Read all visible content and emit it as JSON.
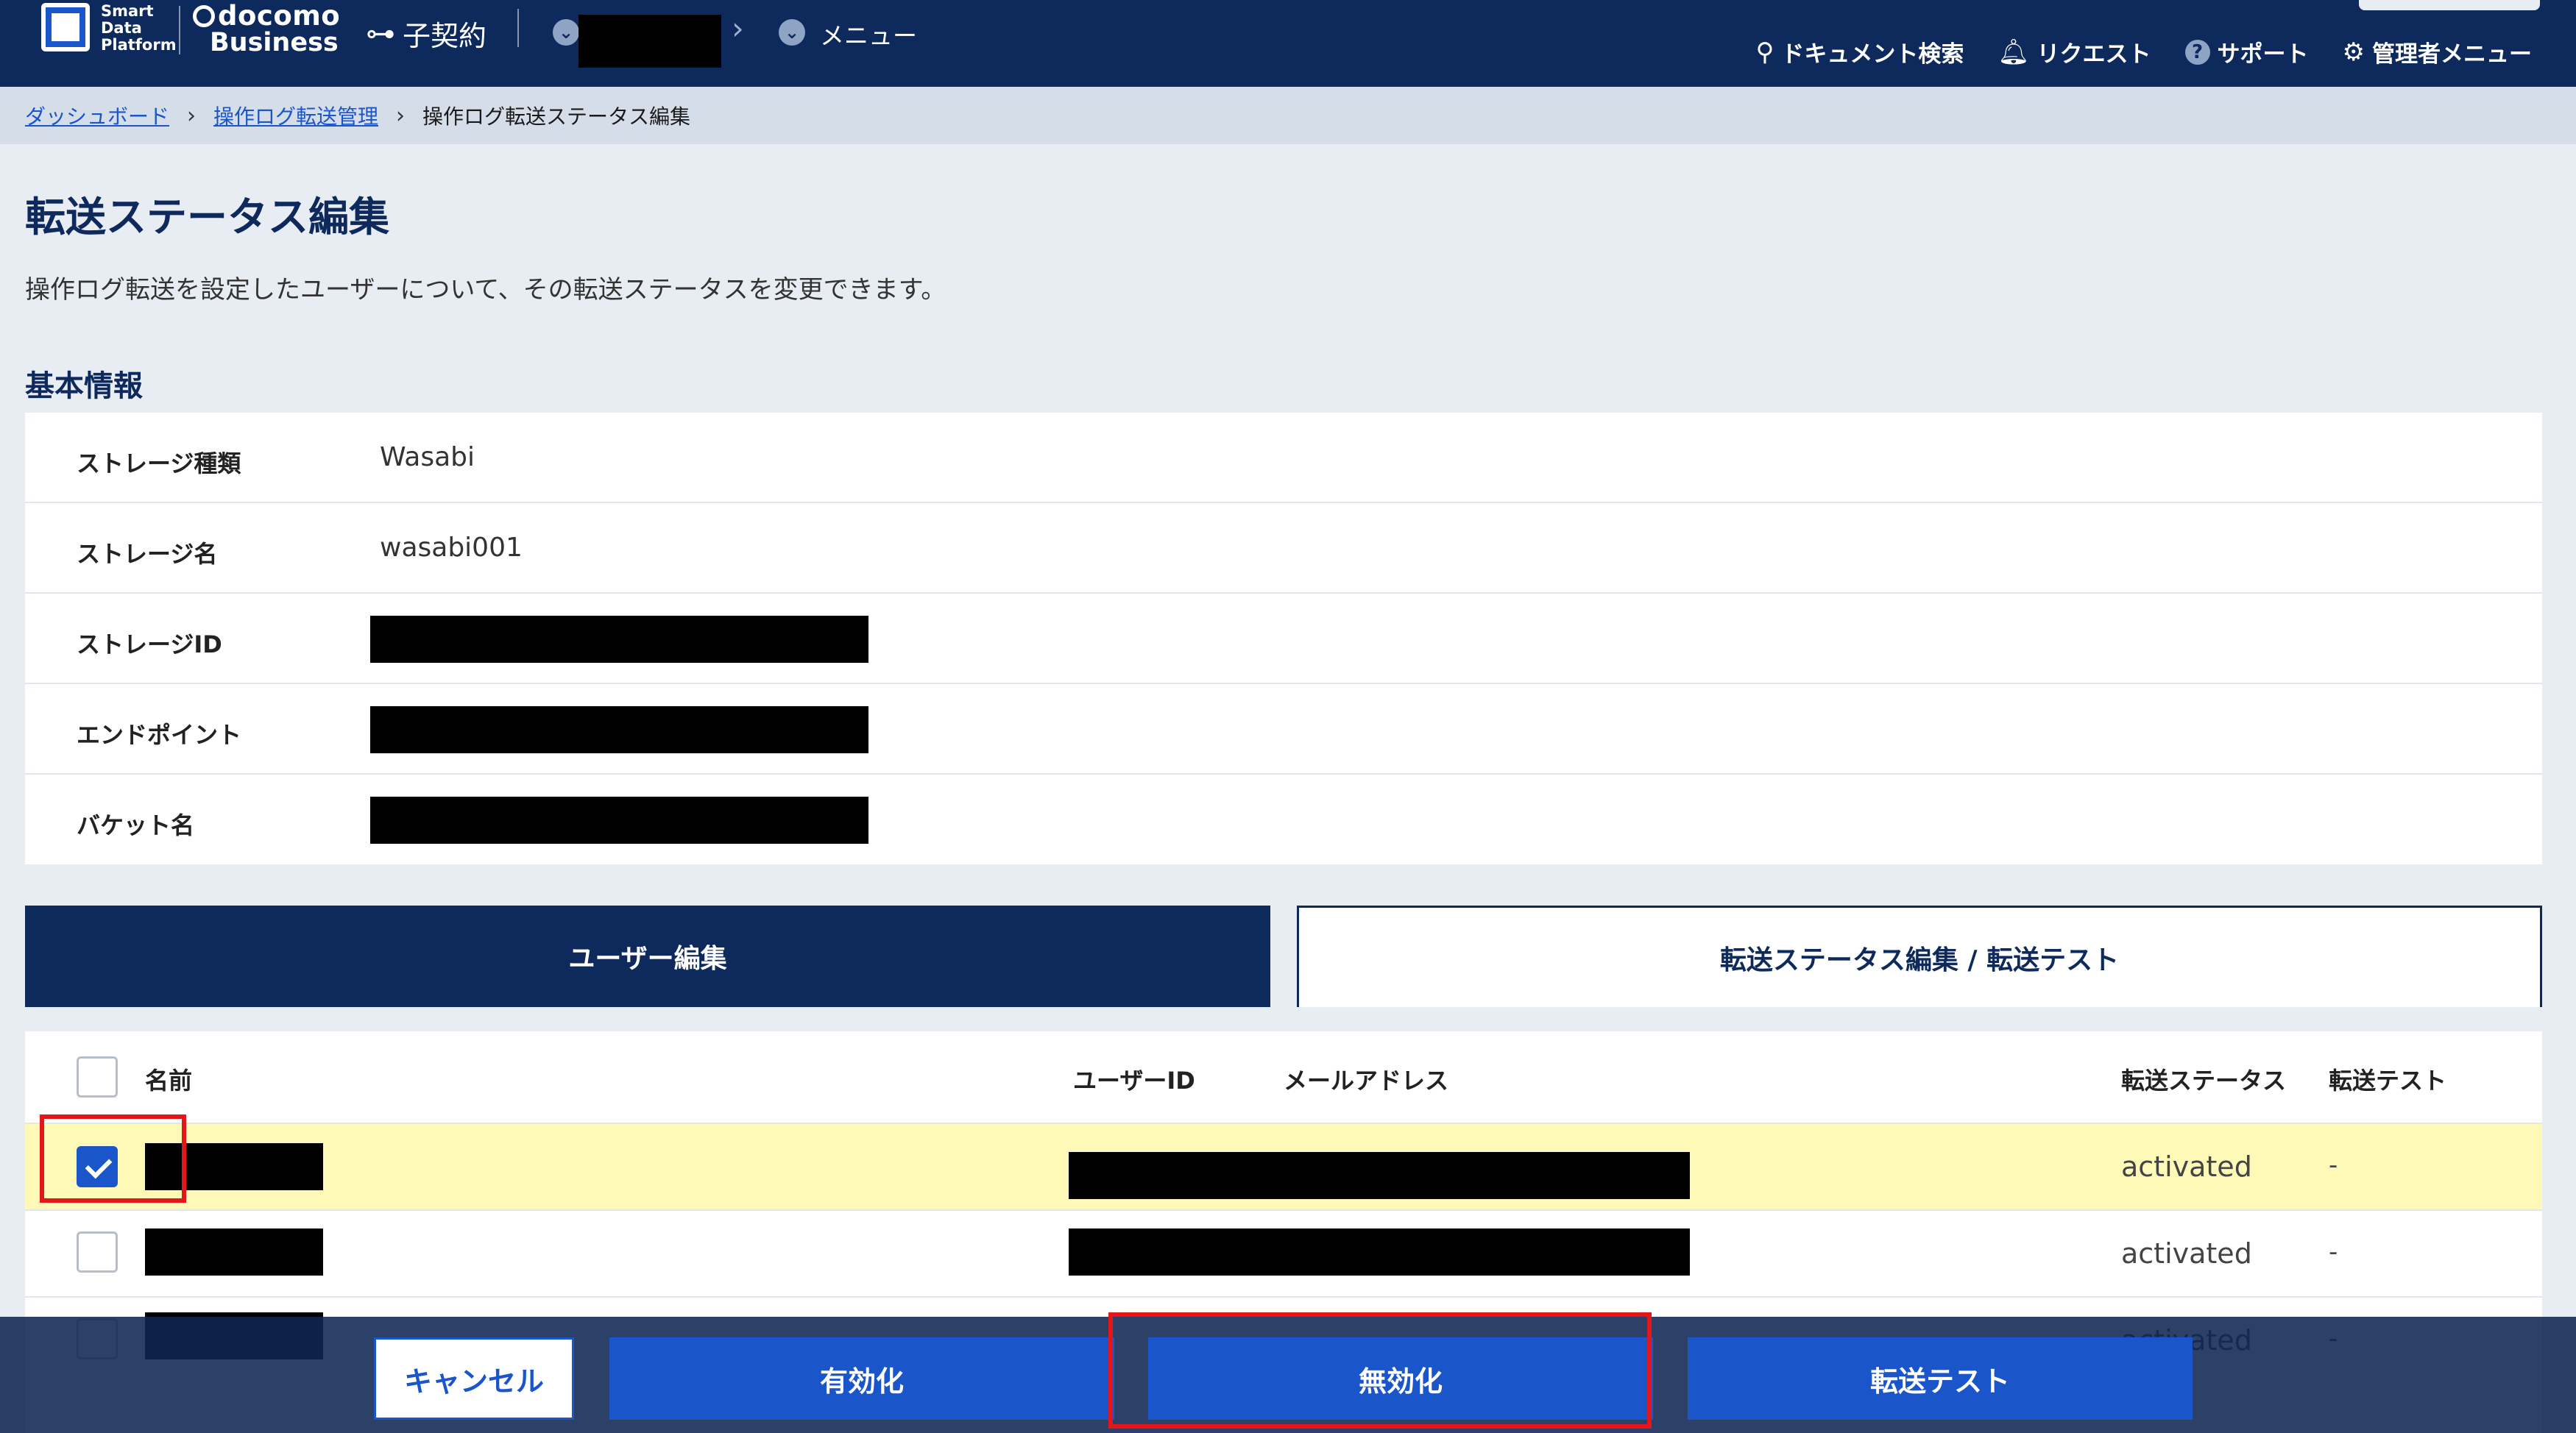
{
  "header": {
    "logo_text": [
      "Smart",
      "Data",
      "Platform"
    ],
    "docomo": "docomo",
    "business": "Business",
    "contract_label": "子契約",
    "menu_label": "メニュー",
    "links": [
      {
        "name": "document-search",
        "icon": "search-icon",
        "glyph": "⚲",
        "label": "ドキュメント検索"
      },
      {
        "name": "request",
        "icon": "bell-icon",
        "glyph": "🔔",
        "label": "リクエスト"
      },
      {
        "name": "support",
        "icon": "help-icon",
        "glyph": "?",
        "label": "サポート"
      },
      {
        "name": "admin-menu",
        "icon": "gear-icon",
        "glyph": "⚙",
        "label": "管理者メニュー"
      }
    ]
  },
  "breadcrumb": {
    "items": [
      "ダッシュボード",
      "操作ログ転送管理",
      "操作ログ転送ステータス編集"
    ]
  },
  "page": {
    "title": "転送ステータス編集",
    "description": "操作ログ転送を設定したユーザーについて、その転送ステータスを変更できます。",
    "section_title": "基本情報"
  },
  "info": {
    "rows": [
      {
        "label": "ストレージ種類",
        "value": "Wasabi",
        "redacted": false
      },
      {
        "label": "ストレージ名",
        "value": "wasabi001",
        "redacted": false
      },
      {
        "label": "ストレージID",
        "value": "",
        "redacted": true
      },
      {
        "label": "エンドポイント",
        "value": "",
        "redacted": true
      },
      {
        "label": "バケット名",
        "value": "",
        "redacted": true
      }
    ]
  },
  "tabs": {
    "user_edit": "ユーザー編集",
    "status_edit": "転送ステータス編集 / 転送テスト"
  },
  "table": {
    "columns": {
      "name": "名前",
      "user_id": "ユーザーID",
      "email": "メールアドレス",
      "status": "転送ステータス",
      "test": "転送テスト"
    },
    "rows": [
      {
        "checked": true,
        "status": "activated",
        "test": "-"
      },
      {
        "checked": false,
        "status": "activated",
        "test": "-"
      },
      {
        "checked": false,
        "status": "activated",
        "test": "-"
      }
    ]
  },
  "actions": {
    "cancel": "キャンセル",
    "activate": "有効化",
    "deactivate": "無効化",
    "transfer_test": "転送テスト"
  },
  "colors": {
    "navy": "#0e2a5c",
    "primary": "#1a56c9",
    "highlight_row": "#fff9b8",
    "annotation_red": "#e3161a"
  }
}
